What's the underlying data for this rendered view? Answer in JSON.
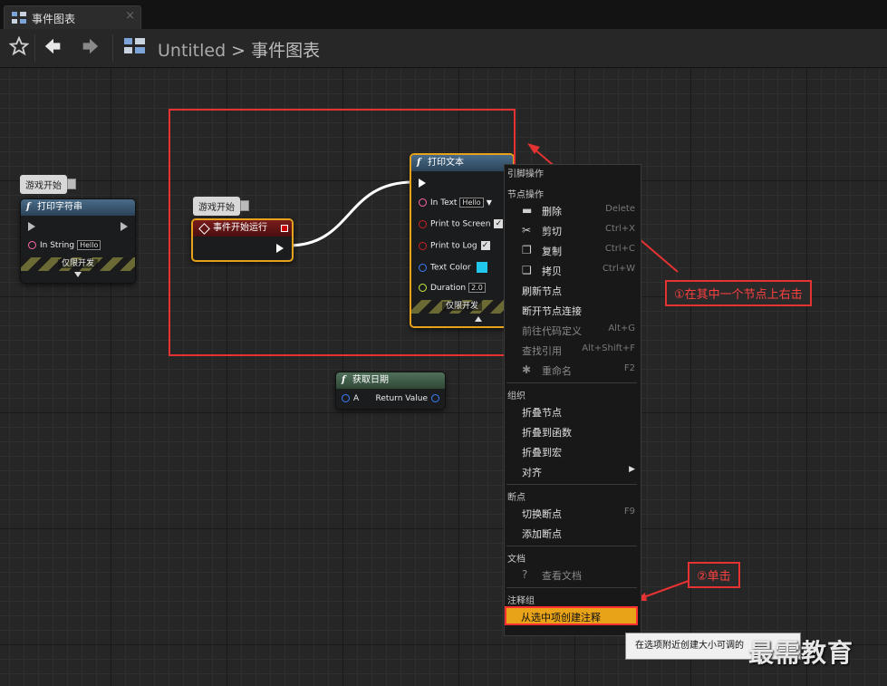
{
  "tab": {
    "title": "事件图表",
    "close_label": "×"
  },
  "breadcrumb": {
    "root": "Untitled",
    "separator": ">",
    "current": "事件图表"
  },
  "nodes": {
    "print_string": {
      "title": "打印字符串",
      "comment": "游戏开始",
      "pin_in_string": "In String",
      "pin_in_string_value": "Hello",
      "dev_only": "仅限开发"
    },
    "begin_play": {
      "title": "事件开始运行",
      "comment": "游戏开始"
    },
    "print_text": {
      "title": "打印文本",
      "pin_in_text": "In Text",
      "pin_in_text_value": "Hello",
      "pin_print_screen": "Print to Screen",
      "pin_print_log": "Print to Log",
      "pin_text_color": "Text Color",
      "pin_duration": "Duration",
      "pin_duration_value": "2.0",
      "dev_only": "仅限开发"
    },
    "get_date": {
      "title": "获取日期",
      "pin_a": "A",
      "pin_return": "Return Value"
    }
  },
  "context_menu": {
    "header": "引脚操作",
    "section_node": "节点操作",
    "items_node": [
      {
        "label": "删除",
        "shortcut": "Delete",
        "icon": "delete-icon"
      },
      {
        "label": "剪切",
        "shortcut": "Ctrl+X",
        "icon": "scissors-icon"
      },
      {
        "label": "复制",
        "shortcut": "Ctrl+C",
        "icon": "copy-icon"
      },
      {
        "label": "拷贝",
        "shortcut": "Ctrl+W",
        "icon": "duplicate-icon"
      },
      {
        "label": "刷新节点",
        "shortcut": ""
      },
      {
        "label": "断开节点连接",
        "shortcut": ""
      },
      {
        "label": "前往代码定义",
        "shortcut": "Alt+G"
      },
      {
        "label": "查找引用",
        "shortcut": "Alt+Shift+F"
      },
      {
        "label": "重命名",
        "shortcut": "F2",
        "icon": "rename-icon"
      }
    ],
    "section_org": "组织",
    "items_org": [
      {
        "label": "折叠节点"
      },
      {
        "label": "折叠到函数"
      },
      {
        "label": "折叠到宏"
      },
      {
        "label": "对齐",
        "submenu": "▶"
      }
    ],
    "section_breakpoint": "断点",
    "items_breakpoint": [
      {
        "label": "切换断点",
        "shortcut": "F9"
      },
      {
        "label": "添加断点"
      }
    ],
    "section_doc": "文档",
    "items_doc": [
      {
        "label": "查看文档",
        "icon": "help-icon"
      }
    ],
    "section_comment": "注释组",
    "highlighted_item": "从选中项创建注释"
  },
  "tooltip": "在选项附近创建大小可调的",
  "callouts": {
    "step1": "①在其中一个节点上右击",
    "step2": "②单击"
  },
  "watermark": "最需教育",
  "colors": {
    "accent": "#e8a318",
    "annotation_red": "#e53232",
    "pin_pink": "#ff66aa",
    "pin_red": "#cc2020",
    "pin_blue": "#3d7dff",
    "pin_yellow_green": "#c8f040",
    "text_color_swatch": "#21c8ee"
  }
}
